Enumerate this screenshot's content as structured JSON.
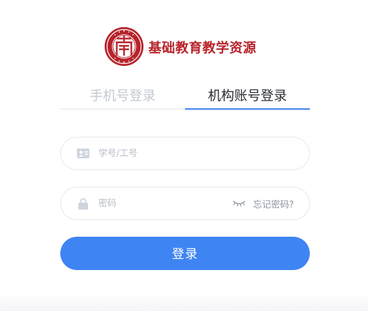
{
  "brand": {
    "title": "基础教育教学资源",
    "seal_color": "#b7242b"
  },
  "tabs": [
    {
      "label": "手机号登录",
      "active": false
    },
    {
      "label": "机构账号登录",
      "active": true
    }
  ],
  "form": {
    "account": {
      "placeholder": "学号/工号",
      "value": "",
      "icon": "id-card-icon"
    },
    "password": {
      "placeholder": "密码",
      "value": "",
      "icon": "lock-icon",
      "toggle_icon": "eye-closed-icon",
      "forgot_label": "忘记密码?"
    },
    "submit_label": "登录"
  },
  "colors": {
    "accent": "#3f84f3",
    "tab_active_text": "#2a2d33",
    "tab_inactive_text": "#c3c8d2",
    "placeholder": "#b6bcc7"
  }
}
